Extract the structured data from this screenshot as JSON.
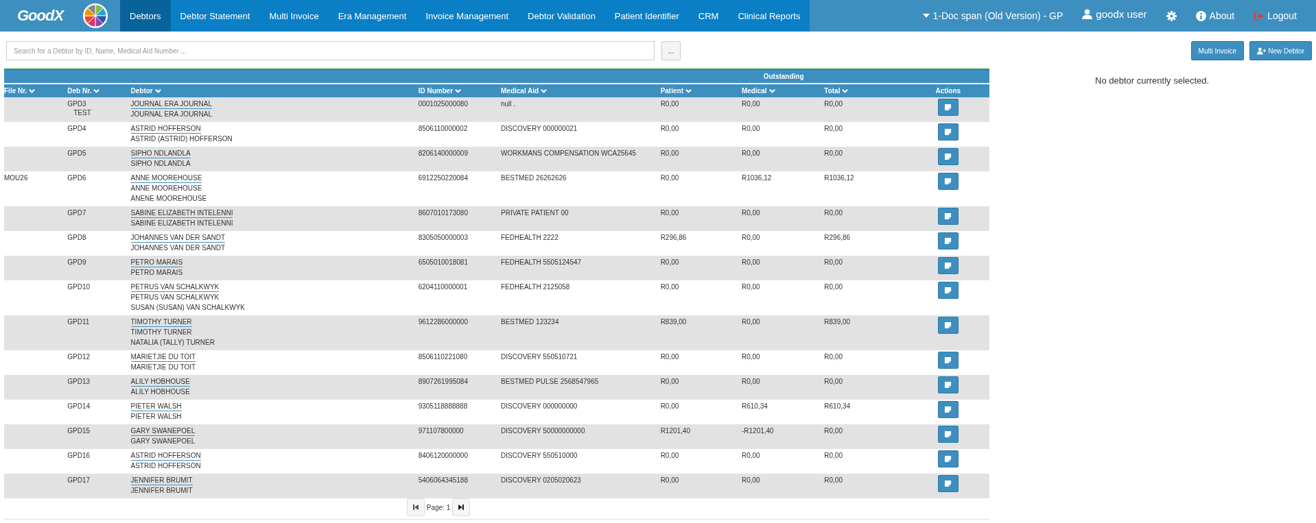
{
  "navbar": {
    "logo_text": "GoodX",
    "tabs": [
      {
        "label": "Debtors",
        "selected": true
      },
      {
        "label": "Debtor Statement",
        "selected": false
      },
      {
        "label": "Multi Invoice",
        "selected": false
      },
      {
        "label": "Era Management",
        "selected": false
      },
      {
        "label": "Invoice Management",
        "selected": false
      },
      {
        "label": "Debtor Validation",
        "selected": false
      },
      {
        "label": "Patient Identifier",
        "selected": false
      },
      {
        "label": "CRM",
        "selected": false
      },
      {
        "label": "Clinical Reports",
        "selected": false
      }
    ],
    "practice": "1-Doc span (Old Version) - GP",
    "user": "goodx user",
    "about": "About",
    "logout": "Logout"
  },
  "search": {
    "placeholder": "Search for a Debtor by ID, Name, Medical Aid Number ...",
    "more_button": "..."
  },
  "buttons": [
    {
      "kind": "plain",
      "label": "Multi Invoice"
    },
    {
      "kind": "add-person",
      "label": "New Debtor"
    }
  ],
  "table": {
    "group_header": "Outstanding",
    "columns": [
      {
        "label": "File Nr.",
        "sortable": true
      },
      {
        "label": "Deb Nr.",
        "sortable": true
      },
      {
        "label": "Debtor",
        "sortable": true
      },
      {
        "label": "ID Number",
        "sortable": true
      },
      {
        "label": "Medical Aid",
        "sortable": true
      },
      {
        "label": "Patient",
        "sortable": true
      },
      {
        "label": "Medical",
        "sortable": true
      },
      {
        "label": "Total",
        "sortable": true
      },
      {
        "label": "Actions",
        "sortable": false
      }
    ],
    "rows": [
      {
        "deb_nr": "GPD3",
        "deb_note": "TEST",
        "names": [
          "JOURNAL ERA JOURNAL",
          "JOURNAL ERA JOURNAL"
        ],
        "id_number": "0001025000080",
        "medical_aid": "null .",
        "patient": "R0,00",
        "medical": "R0,00",
        "total": "R0,00"
      },
      {
        "deb_nr": "GPD4",
        "names": [
          "ASTRID HOFFERSON",
          "ASTRID (ASTRID) HOFFERSON"
        ],
        "id_number": "8506110000002",
        "medical_aid": "DISCOVERY 000000021",
        "patient": "R0,00",
        "medical": "R0,00",
        "total": "R0,00"
      },
      {
        "deb_nr": "GPD5",
        "names": [
          "SIPHO NDLANDLA",
          "SIPHO NDLANDLA"
        ],
        "id_number": "8206140000009",
        "medical_aid": "WORKMANS COMPENSATION WCA25645",
        "patient": "R0,00",
        "medical": "R0,00",
        "total": "R0,00"
      },
      {
        "file_nr": "MOU26",
        "deb_nr": "GPD6",
        "names": [
          "ANNE MOOREHOUSE",
          "ANNE MOOREHOUSE",
          "ANENE MOOREHOUSE"
        ],
        "id_number": "6912250220084",
        "medical_aid": "BESTMED 26262626",
        "patient": "R0,00",
        "medical": "R1036,12",
        "total": "R1036,12"
      },
      {
        "deb_nr": "GPD7",
        "names": [
          "SABINE ELIZABETH INTELENNI",
          "SABINE ELIZABETH INTELENNI"
        ],
        "id_number": "8607010173080",
        "medical_aid": "PRIVATE PATIENT 00",
        "patient": "R0,00",
        "medical": "R0,00",
        "total": "R0,00"
      },
      {
        "deb_nr": "GPD8",
        "names": [
          "JOHANNES VAN DER SANDT",
          "JOHANNES VAN DER SANDT"
        ],
        "id_number": "8305050000003",
        "medical_aid": "FEDHEALTH 2222",
        "patient": "R296,86",
        "medical": "R0,00",
        "total": "R296,86"
      },
      {
        "deb_nr": "GPD9",
        "names": [
          "PETRO MARAIS",
          "PETRO MARAIS"
        ],
        "id_number": "6505010018081",
        "medical_aid": "FEDHEALTH 5505124547",
        "patient": "R0,00",
        "medical": "R0,00",
        "total": "R0,00"
      },
      {
        "deb_nr": "GPD10",
        "names": [
          "PETRUS VAN SCHALKWYK",
          "PETRUS VAN SCHALKWYK",
          "SUSAN (SUSAN) VAN SCHALKWYK"
        ],
        "id_number": "6204110000001",
        "medical_aid": "FEDHEALTH 2125058",
        "patient": "R0,00",
        "medical": "R0,00",
        "total": "R0,00"
      },
      {
        "deb_nr": "GPD11",
        "names": [
          "TIMOTHY TURNER",
          "TIMOTHY TURNER",
          "NATALIA (TALLY) TURNER"
        ],
        "id_number": "9612286000000",
        "medical_aid": "BESTMED 123234",
        "patient": "R839,00",
        "medical": "R0,00",
        "total": "R839,00"
      },
      {
        "deb_nr": "GPD12",
        "names": [
          "MARIETJIE DU TOIT",
          "MARIETJIE DU TOIT"
        ],
        "id_number": "8506110221080",
        "medical_aid": "DISCOVERY 550510721",
        "patient": "R0,00",
        "medical": "R0,00",
        "total": "R0,00"
      },
      {
        "deb_nr": "GPD13",
        "names": [
          "ALILY HOBHOUSE",
          "ALILY HOBHOUSE"
        ],
        "id_number": "8907261995084",
        "medical_aid": "BESTMED PULSE 2568547965",
        "patient": "R0,00",
        "medical": "R0,00",
        "total": "R0,00"
      },
      {
        "deb_nr": "GPD14",
        "names": [
          "PIETER WALSH",
          "PIETER WALSH"
        ],
        "id_number": "9305118888888",
        "medical_aid": "DISCOVERY 000000000",
        "patient": "R0,00",
        "medical": "R610,34",
        "total": "R610,34"
      },
      {
        "deb_nr": "GPD15",
        "names": [
          "GARY SWANEPOEL",
          "GARY SWANEPOEL"
        ],
        "id_number": "971107800000",
        "medical_aid": "DISCOVERY 50000000000",
        "patient": "R1201,40",
        "medical": "-R1201,40",
        "total": "R0,00"
      },
      {
        "deb_nr": "GPD16",
        "names": [
          "ASTRID HOFFERSON",
          "ASTRID HOFFERSON"
        ],
        "id_number": "8406120000000",
        "medical_aid": "DISCOVERY 550510000",
        "patient": "R0,00",
        "medical": "R0,00",
        "total": "R0,00"
      },
      {
        "deb_nr": "GPD17",
        "names": [
          "JENNIFER BRUMIT",
          "JENNIFER BRUMIT"
        ],
        "id_number": "5406064345188",
        "medical_aid": "DISCOVERY 0205020623",
        "patient": "R0,00",
        "medical": "R0,00",
        "total": "R0,00"
      }
    ]
  },
  "pagination": {
    "page_label": "Page: 1"
  },
  "detail_panel": {
    "message": "No debtor currently selected."
  }
}
